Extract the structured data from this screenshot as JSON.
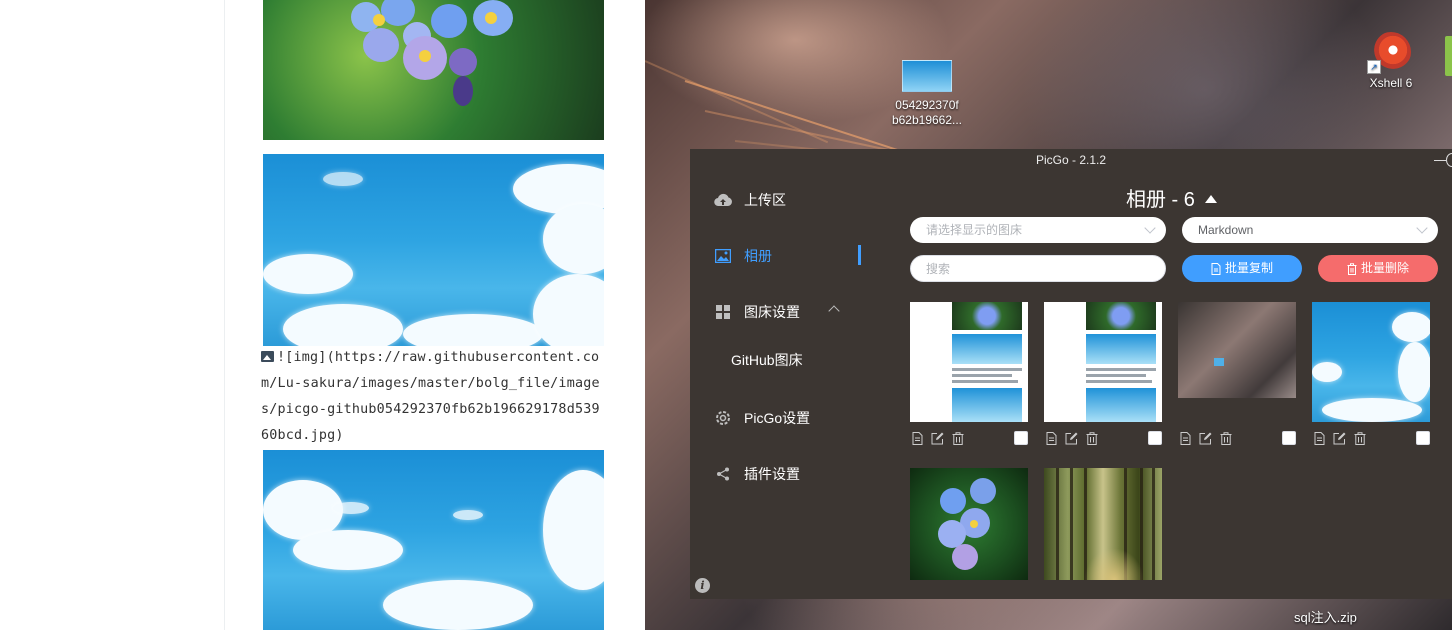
{
  "editor": {
    "markdown_lines": [
      "![img](https://raw.githubusercontent.co",
      "m/Lu-sakura/images/master/bolg_file/image",
      "s/picgo-github054292370fb62b196629178d539",
      "60bcd.jpg)"
    ],
    "image_icon": "image-icon"
  },
  "desktop": {
    "file_icon_label_line1": "054292370f",
    "file_icon_label_line2": "b62b19662...",
    "xshell_label": "Xshell 6",
    "sql_file_label": "sql注入.zip"
  },
  "picgo": {
    "window_title": "PicGo - 2.1.2",
    "menu": [
      {
        "label": "上传区",
        "icon": "cloud-upload-icon",
        "active": false
      },
      {
        "label": "相册",
        "icon": "picture-icon",
        "active": true
      },
      {
        "label": "图床设置",
        "icon": "grid-icon",
        "active": false,
        "expanded": true
      },
      {
        "label": "PicGo设置",
        "icon": "settings-icon",
        "active": false
      },
      {
        "label": "插件设置",
        "icon": "share-icon",
        "active": false
      }
    ],
    "submenu": {
      "label": "GitHub图床"
    },
    "gallery": {
      "title": "相册 - 6",
      "bed_select_placeholder": "请选择显示的图床",
      "format_select_value": "Markdown",
      "search_placeholder": "搜索",
      "copy_button_label": "批量复制",
      "delete_button_label": "批量删除",
      "image_count": 6,
      "item_tools": [
        "copy-icon",
        "edit-icon",
        "delete-icon"
      ]
    },
    "colors": {
      "accent": "#409eff",
      "danger": "#f56c6c",
      "window_bg": "#3c3632"
    }
  }
}
